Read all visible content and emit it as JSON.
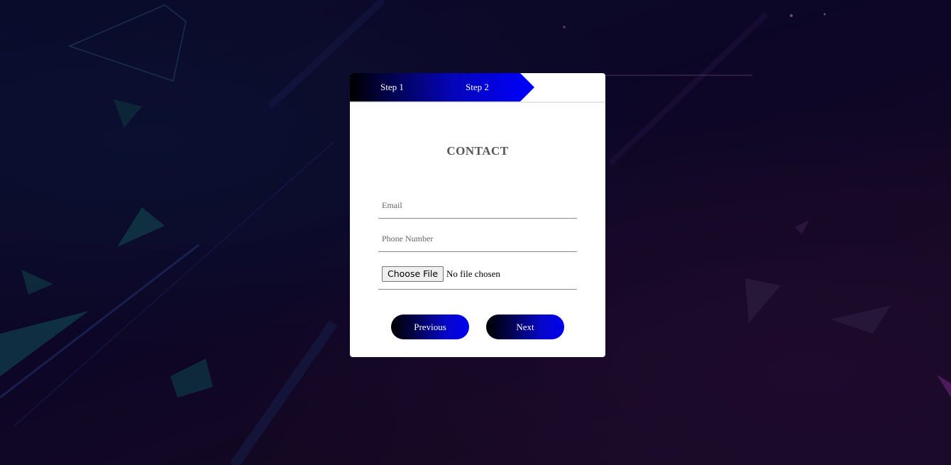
{
  "steps": [
    "Step 1",
    "Step 2"
  ],
  "form": {
    "title": "CONTACT",
    "email_placeholder": "Email",
    "phone_placeholder": "Phone Number",
    "file_button": "Choose File",
    "file_status": "No file chosen"
  },
  "buttons": {
    "previous": "Previous",
    "next": "Next"
  },
  "colors": {
    "accent": "#0000ff",
    "dark": "#000000",
    "card": "#ffffff"
  }
}
